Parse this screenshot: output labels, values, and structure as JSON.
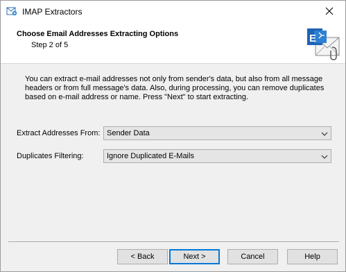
{
  "window": {
    "title": "IMAP Extractors"
  },
  "header": {
    "title": "Choose Email Addresses Extracting Options",
    "step": "Step 2 of 5",
    "icon": "exchange-mail-icon"
  },
  "description": "You can extract e-mail addresses not only from sender's data, but also from all message headers or from full message's data. Also, during processing, you can remove duplicates based on e-mail address or name. Press \"Next\" to start extracting.",
  "form": {
    "extract_from": {
      "label": "Extract Addresses From:",
      "value": "Sender Data"
    },
    "duplicates": {
      "label": "Duplicates Filtering:",
      "value": "Ignore Duplicated E-Mails"
    }
  },
  "buttons": {
    "back": "< Back",
    "next": "Next >",
    "cancel": "Cancel",
    "help": "Help"
  },
  "colors": {
    "accent": "#0078d7",
    "exchange_blue": "#1e64b4"
  }
}
